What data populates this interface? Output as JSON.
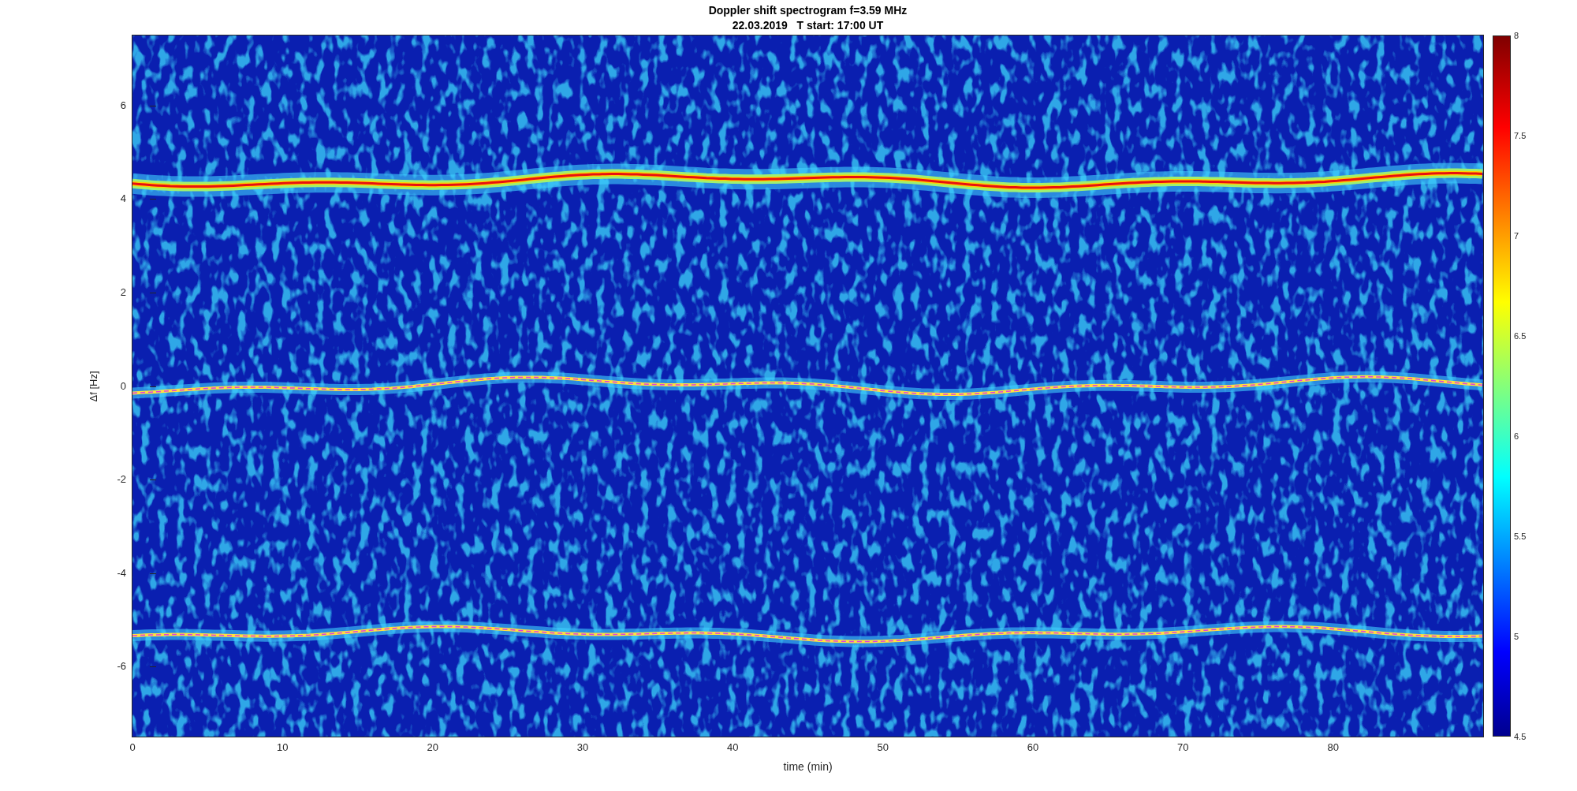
{
  "title": "Doppler shift spectrogram f=3.59 MHz",
  "subtitle": "22.03.2019   T start: 17:00 UT",
  "xlabel": "time (min)",
  "ylabel": "Δf [Hz]",
  "xticks": [
    "0",
    "10",
    "20",
    "30",
    "40",
    "50",
    "60",
    "70",
    "80"
  ],
  "yticks": [
    "6",
    "4",
    "2",
    "0",
    "-2",
    "-4",
    "-6"
  ],
  "colorbar_ticks": [
    "8",
    "7.5",
    "7",
    "6.5",
    "6",
    "5.5",
    "5",
    "4.5"
  ]
}
